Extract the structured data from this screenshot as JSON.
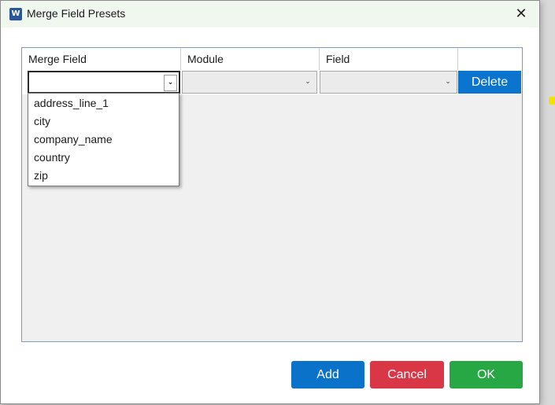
{
  "window": {
    "title": "Merge Field Presets",
    "app_icon_letter": "W",
    "close_glyph": "✕"
  },
  "grid": {
    "columns": [
      "Merge Field",
      "Module",
      "Field"
    ],
    "delete_label": "Delete"
  },
  "dropdown": {
    "open": true,
    "options": [
      "address_line_1",
      "city",
      "company_name",
      "country",
      "zip"
    ]
  },
  "buttons": {
    "add_label": "Add",
    "cancel_label": "Cancel",
    "ok_label": "OK"
  },
  "icons": {
    "combo_arrow": "⌄",
    "app": "word-icon"
  },
  "colors": {
    "titlebar": "#f0f7ef",
    "delete": "#0a74cf",
    "add": "#0b72c9",
    "cancel": "#d93646",
    "ok": "#28a745"
  }
}
